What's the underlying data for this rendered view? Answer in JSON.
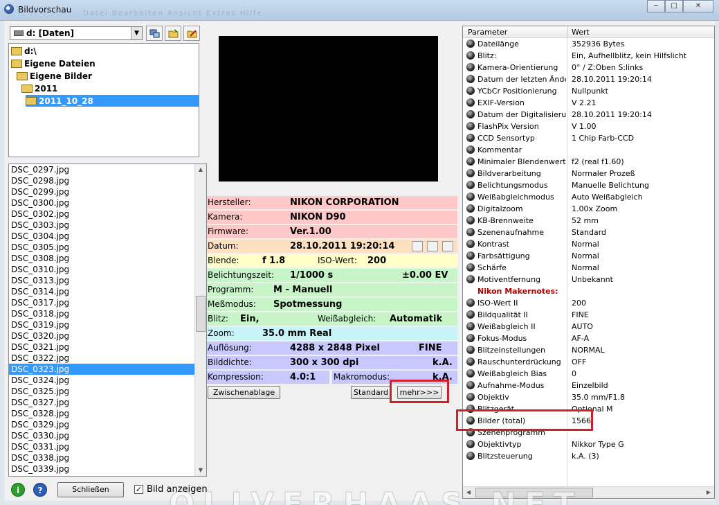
{
  "window": {
    "title": "Bildvorschau",
    "menu_ghost": "Datei  Bearbeiten  Ansicht  Extras  Hilfe"
  },
  "drive": {
    "label": "d: [Daten]"
  },
  "tree": [
    {
      "label": "d:\\",
      "indent": 0
    },
    {
      "label": "Eigene Dateien",
      "indent": 1
    },
    {
      "label": "Eigene Bilder",
      "indent": 2
    },
    {
      "label": "2011",
      "indent": 3
    },
    {
      "label": "2011_10_28",
      "indent": 4,
      "selected": true
    }
  ],
  "files": [
    "DSC_0297.jpg",
    "DSC_0298.jpg",
    "DSC_0299.jpg",
    "DSC_0300.jpg",
    "DSC_0302.jpg",
    "DSC_0303.jpg",
    "DSC_0304.jpg",
    "DSC_0305.jpg",
    "DSC_0308.jpg",
    "DSC_0310.jpg",
    "DSC_0313.jpg",
    "DSC_0314.jpg",
    "DSC_0317.jpg",
    "DSC_0318.jpg",
    "DSC_0319.jpg",
    "DSC_0320.jpg",
    "DSC_0321.jpg",
    "DSC_0322.jpg",
    "DSC_0323.jpg",
    "DSC_0324.jpg",
    "DSC_0325.jpg",
    "DSC_0327.jpg",
    "DSC_0328.jpg",
    "DSC_0329.jpg",
    "DSC_0330.jpg",
    "DSC_0331.jpg",
    "DSC_0338.jpg",
    "DSC_0339.jpg"
  ],
  "selected_file": "DSC_0323.jpg",
  "bottom": {
    "info_icon": "i",
    "help_icon": "?",
    "close_label": "Schließen",
    "show_image_label": "Bild anzeigen",
    "show_image_checked": true
  },
  "info": {
    "hersteller_label": "Hersteller:",
    "hersteller": "NIKON CORPORATION",
    "kamera_label": "Kamera:",
    "kamera": "NIKON D90",
    "firmware_label": "Firmware:",
    "firmware": "Ver.1.00",
    "datum_label": "Datum:",
    "datum": "28.10.2011 19:20:14",
    "blende_label": "Blende:",
    "blende": "f 1.8",
    "iso_label": "ISO-Wert:",
    "iso": "200",
    "belichtung_label": "Belichtungszeit:",
    "belichtung": "1/1000 s",
    "ev": "±0.00 EV",
    "programm_label": "Programm:",
    "programm": "M - Manuell",
    "messmodus_label": "Meßmodus:",
    "messmodus": "Spotmessung",
    "blitz_label": "Blitz:",
    "blitz": "Ein,",
    "wb_label": "Weißabgleich:",
    "wb": "Automatik",
    "zoom_label": "Zoom:",
    "zoom": "35.0 mm Real",
    "aufloesung_label": "Auflösung:",
    "aufloesung": "4288 x 2848 Pixel",
    "qualitaet": "FINE",
    "bilddichte_label": "Bilddichte:",
    "bilddichte": "300 x 300 dpi",
    "bilddichte_ka": "k.A.",
    "kompression_label": "Kompression:",
    "kompression": "4.0:1",
    "makro_label": "Makromodus:",
    "makro": "k.A."
  },
  "buttons": {
    "clipboard": "Zwischenablage",
    "standard": "Standard",
    "more": "mehr>>>"
  },
  "grid": {
    "col_param": "Parameter",
    "col_value": "Wert",
    "rows": [
      {
        "n": "Dateilänge",
        "v": "352936 Bytes"
      },
      {
        "n": "Blitz:",
        "v": "Ein, Aufhellblitz, kein Hilfslicht"
      },
      {
        "n": "Kamera-Orientierung",
        "v": "0° / Z:Oben S:links"
      },
      {
        "n": "Datum der letzten Änder...",
        "v": "28.10.2011 19:20:14"
      },
      {
        "n": "YCbCr Positionierung",
        "v": "Nullpunkt"
      },
      {
        "n": "EXIF-Version",
        "v": "V 2.21"
      },
      {
        "n": "Datum der Digitalisierung",
        "v": "28.10.2011 19:20:14"
      },
      {
        "n": "FlashPix Version",
        "v": "V 1.00"
      },
      {
        "n": "CCD Sensortyp",
        "v": "1 Chip Farb-CCD"
      },
      {
        "n": "Kommentar",
        "v": ""
      },
      {
        "n": "Minimaler Blendenwert",
        "v": "f2 (real f1.60)"
      },
      {
        "n": "Bildverarbeitung",
        "v": "Normaler Prozeß"
      },
      {
        "n": "Belichtungsmodus",
        "v": "Manuelle Belichtung"
      },
      {
        "n": "Weißabgleichmodus",
        "v": "Auto Weißabgleich"
      },
      {
        "n": "Digitalzoom",
        "v": "1.00x Zoom"
      },
      {
        "n": "KB-Brennweite",
        "v": "52 mm"
      },
      {
        "n": "Szenenaufnahme",
        "v": "Standard"
      },
      {
        "n": "Kontrast",
        "v": "Normal"
      },
      {
        "n": "Farbsättigung",
        "v": "Normal"
      },
      {
        "n": "Schärfe",
        "v": "Normal"
      },
      {
        "n": "Motiventfernung",
        "v": "Unbekannt"
      },
      {
        "n": "Nikon Makernotes:",
        "v": "",
        "header": true
      },
      {
        "n": "ISO-Wert II",
        "v": "200"
      },
      {
        "n": "Bildqualität II",
        "v": "FINE"
      },
      {
        "n": "Weißabgleich II",
        "v": "AUTO"
      },
      {
        "n": "Fokus-Modus",
        "v": "AF-A"
      },
      {
        "n": "Blitzeinstellungen",
        "v": "NORMAL"
      },
      {
        "n": "Rauschunterdrückung",
        "v": "OFF"
      },
      {
        "n": "Weißabgleich Bias",
        "v": "0"
      },
      {
        "n": "Aufnahme-Modus",
        "v": "Einzelbild"
      },
      {
        "n": "Objektiv",
        "v": "35.0 mm/F1.8"
      },
      {
        "n": "Blitzgerät",
        "v": "Optional M"
      },
      {
        "n": "Bilder (total)",
        "v": "1566"
      },
      {
        "n": "Szenenprogramm",
        "v": ""
      },
      {
        "n": "Objektivtyp",
        "v": "Nikkor Type G"
      },
      {
        "n": "Blitzsteuerung",
        "v": "k.A. (3)"
      }
    ]
  },
  "watermark": "OLIVERHAAS.NET",
  "colors": {
    "selection": "#3399ff",
    "highlight_box": "#d0202b",
    "pink": "#ffc8c8",
    "peach": "#fde0c0",
    "yellow": "#ffffc8",
    "green": "#c8f5c8",
    "cyan": "#c8f5fa",
    "lavender": "#c8c8ff"
  }
}
